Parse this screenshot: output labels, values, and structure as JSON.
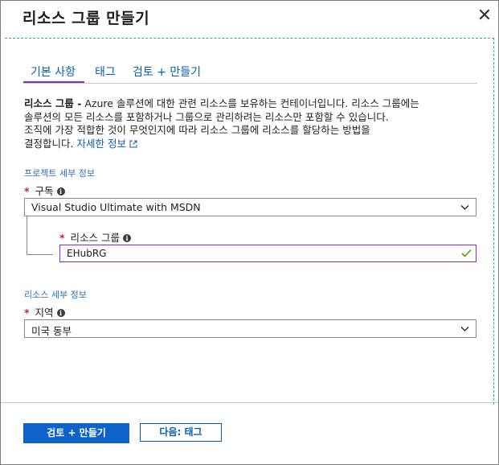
{
  "blade": {
    "title": "리소스 그룹 만들기",
    "close_glyph": "✕"
  },
  "tabs": [
    {
      "label": "기본 사항",
      "active": true
    },
    {
      "label": "태그",
      "active": false
    },
    {
      "label": "검토 + 만들기",
      "active": false
    }
  ],
  "description": {
    "term": "리소스 그룹 -",
    "line1": " Azure 솔루션에 대한 관련 리소스를 보유하는 컨테이너입니다. 리소스 그룹에는",
    "line2": "솔루션의 모든 리소스를 포함하거나 그룹으로 관리하려는 리소스만 포함할 수 있습니다.",
    "line3": "조직에 가장 적합한 것이 무엇인지에 따라 리소스 그룹에 리소스를 할당하는 방법을",
    "line4": "결정합니다.",
    "learn_more": "자세한 정보",
    "learn_more_icon": "external-link-icon"
  },
  "project_details": {
    "heading": "프로젝트 세부 정보",
    "subscription": {
      "label": "구독",
      "required_mark": "*",
      "value": "Visual Studio Ultimate with MSDN"
    },
    "resource_group": {
      "label": "리소스 그룹",
      "required_mark": "*",
      "value": "EHubRG",
      "valid": true
    }
  },
  "resource_details": {
    "heading": "리소스 세부 정보",
    "region": {
      "label": "지역",
      "required_mark": "*",
      "value": "미국 동부"
    }
  },
  "footer": {
    "primary_button": "검토 + 만들기",
    "secondary_button": "다음: 태그"
  },
  "colors": {
    "accent_link": "#0b5cad",
    "primary_button": "#0f62c9",
    "tab_underline": "#8a2ec0",
    "required": "#c4262e",
    "valid_check": "#57a300",
    "dashed_focus": "#28a7c5"
  }
}
